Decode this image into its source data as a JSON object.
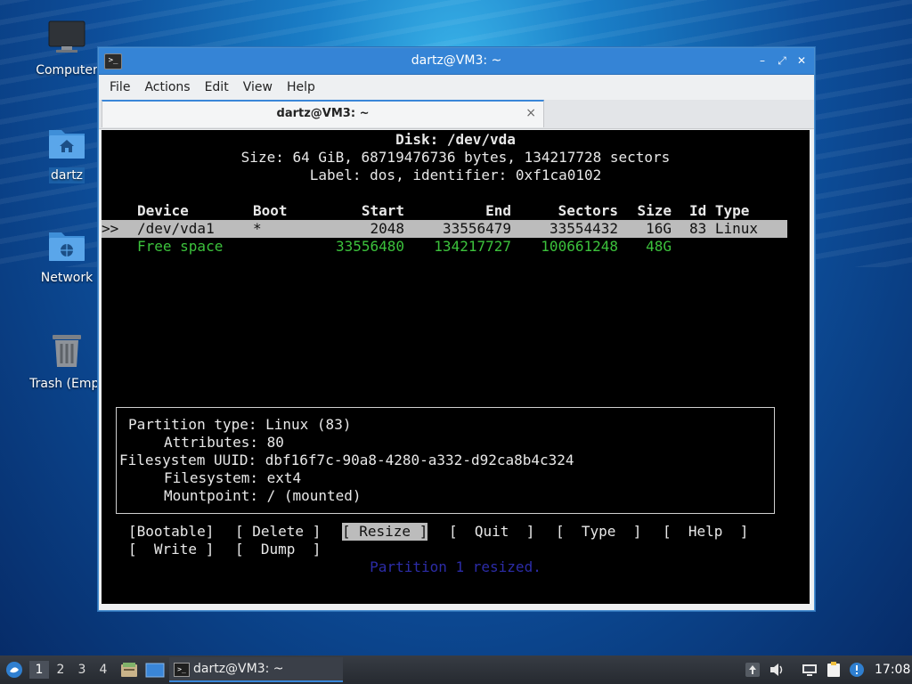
{
  "desktop": {
    "icons": [
      {
        "label": "Computer",
        "icon": "monitor-icon"
      },
      {
        "label": "dartz",
        "icon": "home-folder-icon"
      },
      {
        "label": "Network",
        "icon": "network-folder-icon"
      },
      {
        "label": "Trash (Empt",
        "icon": "trash-icon"
      }
    ]
  },
  "window": {
    "title": "dartz@VM3: ~",
    "menu": [
      "File",
      "Actions",
      "Edit",
      "View",
      "Help"
    ],
    "tab_label": "dartz@VM3: ~",
    "tab_close": "×"
  },
  "terminal": {
    "disk_line": "Disk: /dev/vda",
    "size_line": "Size: 64 GiB, 68719476736 bytes, 134217728 sectors",
    "label_line": "Label: dos, identifier: 0xf1ca0102",
    "columns": [
      "Device",
      "Boot",
      "Start",
      "End",
      "Sectors",
      "Size",
      "Id Type"
    ],
    "cursor": ">>",
    "rows": [
      {
        "device": "/dev/vda1",
        "boot": "*",
        "start": "2048",
        "end": "33556479",
        "sectors": "33554432",
        "size": "16G",
        "idtype": "83 Linux",
        "selected": true
      },
      {
        "device": "Free space",
        "boot": "",
        "start": "33556480",
        "end": "134217727",
        "sectors": "100661248",
        "size": "48G",
        "idtype": "",
        "selected": false
      }
    ],
    "info": {
      "partition_type": "Partition type: Linux (83)",
      "attributes": "Attributes: 80",
      "uuid": "Filesystem UUID: dbf16f7c-90a8-4280-a332-d92ca8b4c324",
      "filesystem": "Filesystem: ext4",
      "mountpoint": "Mountpoint: / (mounted)"
    },
    "buttons": {
      "bootable": "[Bootable]",
      "delete": "[ Delete ]",
      "resize": "[ Resize ]",
      "quit": "[  Quit  ]",
      "type": "[  Type  ]",
      "help": "[  Help  ]",
      "write": "[  Write ]",
      "dump": "[  Dump  ]"
    },
    "status": "Partition 1 resized."
  },
  "taskbar": {
    "workspaces": [
      "1",
      "2",
      "3",
      "4"
    ],
    "active_workspace": "1",
    "task_label": "dartz@VM3: ~",
    "clock": "17:08"
  }
}
